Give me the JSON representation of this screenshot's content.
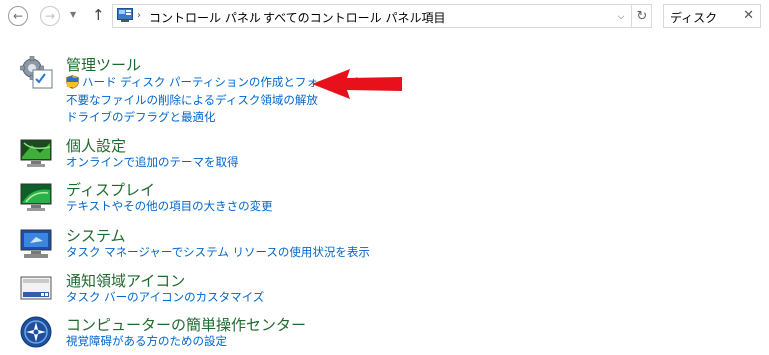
{
  "breadcrumb": [
    "コントロール パネル",
    "すべてのコントロール パネル項目"
  ],
  "search": {
    "value": "ディスク"
  },
  "results": [
    {
      "id": "admin-tools",
      "icon": "admin-tools-icon",
      "title": "管理ツール",
      "links": [
        "ハード ディスク パーティションの作成とフォーマット",
        "不要なファイルの削除によるディスク領域の解放",
        "ドライブのデフラグと最適化"
      ]
    },
    {
      "id": "personalization",
      "icon": "personalization-icon",
      "title": "個人設定",
      "links": [
        "オンラインで追加のテーマを取得"
      ]
    },
    {
      "id": "display",
      "icon": "display-icon",
      "title": "ディスプレイ",
      "links": [
        "テキストやその他の項目の大きさの変更"
      ]
    },
    {
      "id": "system",
      "icon": "system-icon",
      "title": "システム",
      "links": [
        "タスク マネージャーでシステム リソースの使用状況を表示"
      ]
    },
    {
      "id": "notification-area",
      "icon": "notification-area-icon",
      "title": "通知領域アイコン",
      "links": [
        "タスク バーのアイコンのカスタマイズ"
      ]
    },
    {
      "id": "ease-of-access",
      "icon": "ease-of-access-icon",
      "title": "コンピューターの簡単操作センター",
      "links": [
        "視覚障碍がある方のための設定"
      ]
    }
  ],
  "colors": {
    "title": "#1e6a2e",
    "link": "#0066cc",
    "annotation_arrow": "#e8101a"
  }
}
